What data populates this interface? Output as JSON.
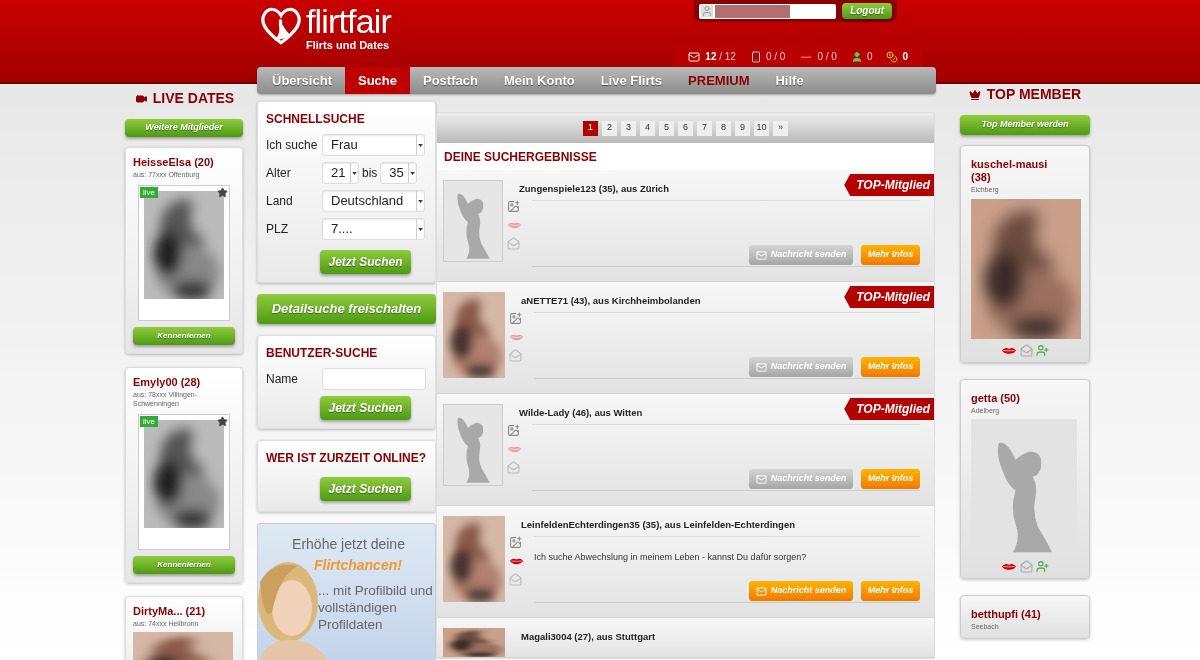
{
  "header": {
    "logo": {
      "part1": "flirt",
      "part2": "fair",
      "tagline": "Flirts und Dates"
    },
    "logout": "Logout",
    "stats": [
      {
        "kind": "mail",
        "text": "**12** / 12"
      },
      {
        "kind": "phone",
        "text": "0 / 0"
      },
      {
        "kind": "kiss",
        "text": "0 / 0"
      },
      {
        "kind": "contact",
        "text": "0"
      },
      {
        "kind": "coins",
        "text": "**0**"
      }
    ]
  },
  "nav": [
    {
      "label": "Übersicht",
      "selected": false,
      "highlight": false
    },
    {
      "label": "Suche",
      "selected": true,
      "highlight": false
    },
    {
      "label": "Postfach",
      "selected": false,
      "highlight": false
    },
    {
      "label": "Mein Konto",
      "selected": false,
      "highlight": false
    },
    {
      "label": "Live Flirts",
      "selected": false,
      "highlight": false
    },
    {
      "label": "PREMIUM",
      "selected": false,
      "highlight": true
    },
    {
      "label": "Hilfe",
      "selected": false,
      "highlight": false
    }
  ],
  "live_dates": {
    "title": "LIVE DATES",
    "button": "Weitere Mitglieder",
    "cards": [
      {
        "name": "HeisseElsa (20)",
        "location": "aus: 77xxx Offenburg",
        "live": "live",
        "button": "Kennenlernen"
      },
      {
        "name": "Emyly00 (28)",
        "location": "aus: 78xxx Villingen-Schwenningen",
        "live": "live",
        "button": "Kennenlernen"
      },
      {
        "name": "DirtyMa... (21)",
        "location": "aus: 74xxx Heilbronn"
      }
    ]
  },
  "quick_search": {
    "title": "SCHNELLSUCHE",
    "fields": [
      {
        "kind": "select",
        "label": "Ich suche",
        "value": "Frau"
      },
      {
        "kind": "range",
        "label": "Alter",
        "from": "21",
        "separator": "bis",
        "to": "35"
      },
      {
        "kind": "select",
        "label": "Land",
        "value": "Deutschland"
      },
      {
        "kind": "select",
        "label": "PLZ",
        "value": "7...."
      }
    ],
    "button": "Jetzt Suchen"
  },
  "detail_button": "Detailsuche freischalten",
  "user_search": {
    "title": "BENUTZER-SUCHE",
    "label": "Name",
    "button": "Jetzt Suchen"
  },
  "online": {
    "title": "WER IST ZURZEIT ONLINE?",
    "button": "Jetzt Suchen"
  },
  "promo": {
    "line1": "Erhöhe jetzt deine",
    "highlight": "Flirtchancen!",
    "line2": "... mit Profilbild und vollständigen Profildaten"
  },
  "results": {
    "pages": [
      {
        "label": "1",
        "selected": true
      },
      {
        "label": "2",
        "selected": false
      },
      {
        "label": "3",
        "selected": false
      },
      {
        "label": "4",
        "selected": false
      },
      {
        "label": "5",
        "selected": false
      },
      {
        "label": "6",
        "selected": false
      },
      {
        "label": "7",
        "selected": false
      },
      {
        "label": "8",
        "selected": false
      },
      {
        "label": "9",
        "selected": false
      },
      {
        "label": "10",
        "selected": false
      },
      {
        "label": "»",
        "selected": false
      }
    ],
    "title": "DEINE SUCHERGEBNISSE",
    "items": [
      {
        "name": "Zungenspiele123 (35), aus Zürich",
        "photo": {
          "kind": "placeholder"
        },
        "badge": "TOP-Mitglied",
        "kiss_active": false,
        "message_enabled": false,
        "message": "Nachricht senden",
        "info": "Mehr Infos"
      },
      {
        "name": "aNETTE71 (43), aus Kirchheimbolanden",
        "badge": "TOP-Mitglied",
        "kiss_active": false,
        "message_enabled": false,
        "message": "Nachricht senden",
        "info": "Mehr Infos"
      },
      {
        "name": "Wilde-Lady (46), aus Witten",
        "photo": {
          "kind": "placeholder"
        },
        "badge": "TOP-Mitglied",
        "kiss_active": false,
        "message_enabled": false,
        "message": "Nachricht senden",
        "info": "Mehr Infos"
      },
      {
        "name": "LeinfeldenEchterdingen35 (35), aus Leinfelden-Echterdingen",
        "text": "Ich suche Abwechslung in meinem Leben - kannst Du dafür sorgen?",
        "kiss_active": true,
        "message_enabled": true,
        "message": "Nachricht senden",
        "info": "Mehr Infos"
      },
      {
        "name": "Magali3004 (27), aus Stuttgart"
      }
    ]
  },
  "top_member": {
    "title": "TOP MEMBER",
    "button": "Top Member werden",
    "cards": [
      {
        "name": "kuschel-mausi (38)",
        "location": "Eichberg"
      },
      {
        "name": "getta (50)",
        "location": "Adelberg",
        "photo": {
          "kind": "placeholder"
        }
      },
      {
        "name": "betthupfi (41)",
        "location": "Seebach"
      }
    ]
  }
}
